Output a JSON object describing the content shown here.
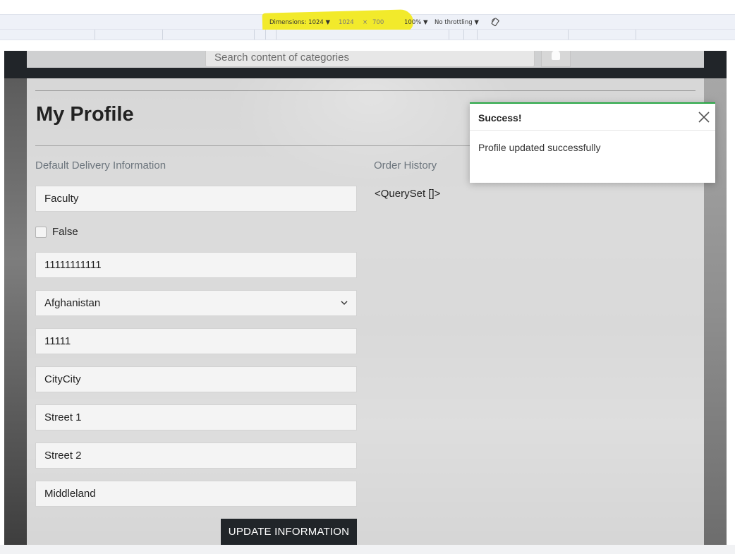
{
  "devtools": {
    "dimensions_label": "Dimensions: 1024 ▼",
    "width_value": "1024",
    "times": "×",
    "height_value": "700",
    "zoom_label": "100% ▼",
    "throttle_label": "No throttling ▼"
  },
  "navbar": {
    "search_placeholder": "Search content of categories"
  },
  "profile": {
    "title": "My Profile",
    "delivery_heading": "Default Delivery Information",
    "fields": {
      "name": "Faculty",
      "checkbox_label": "False",
      "phone": "11111111111",
      "country": "Afghanistan",
      "postcode": "11111",
      "city": "CityCity",
      "street1": "Street 1",
      "street2": "Street 2",
      "county": "Middleland"
    },
    "update_button": "UPDATE INFORMATION",
    "order_history_heading": "Order History",
    "order_history_value": "<QuerySet []>"
  },
  "toast": {
    "title": "Success!",
    "message": "Profile updated successfully",
    "accent_color": "#28a745"
  }
}
